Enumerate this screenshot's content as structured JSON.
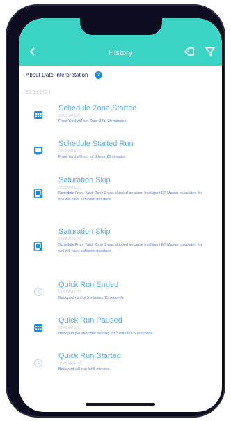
{
  "header": {
    "title": "History"
  },
  "about": {
    "label": "About Date Interpretation",
    "info_glyph": "?"
  },
  "date_label": "23 Jul 2021",
  "events": [
    {
      "title": "Schedule Zone Started",
      "time": "09:01 AM EDT",
      "description": "Front Yard will run Zone 3 for 30 minutes.",
      "icon": "schedule-calendar-icon"
    },
    {
      "title": "Schedule Started Run",
      "time": "09:00 AM EDT",
      "description": "Front Yard will run for 1 hour 28 minutes.",
      "icon": "schedule-screen-icon"
    },
    {
      "title": "Saturation Skip",
      "time": "08:58 AM EDT",
      "description": "Schedule Front Yard: Zone 2 was skipped because Intelligent ET Master calculated the soil will have sufficient moisture.",
      "icon": "saturation-document-icon"
    },
    {
      "title": "Saturation Skip",
      "time": "08:58 AM EDT",
      "description": "Schedule Front Yard: Zone 1 was skipped because Intelligent ET Master calculated the soil will have sufficient moisture.",
      "icon": "saturation-document-icon"
    },
    {
      "title": "Quick Run Ended",
      "time": "08:52 AM EDT",
      "description": "Backyard ran for 5 minutes 15 seconds.",
      "icon": "quick-run-clock-icon"
    },
    {
      "title": "Quick Run Paused",
      "time": "08:49 AM EDT",
      "description": "Backyard paused after running for 3 minutes 50 seconds.",
      "icon": "quick-run-pause-icon"
    },
    {
      "title": "Quick Run Started",
      "time": "08:45 AM EDT",
      "description": "Backyard will run for 5 minutes.",
      "icon": "quick-run-clock-icon"
    }
  ],
  "colors": {
    "header": "#3cd4c4",
    "title": "#5db0ea",
    "description": "#5a7fc8",
    "icon": "#1c8fe0"
  }
}
